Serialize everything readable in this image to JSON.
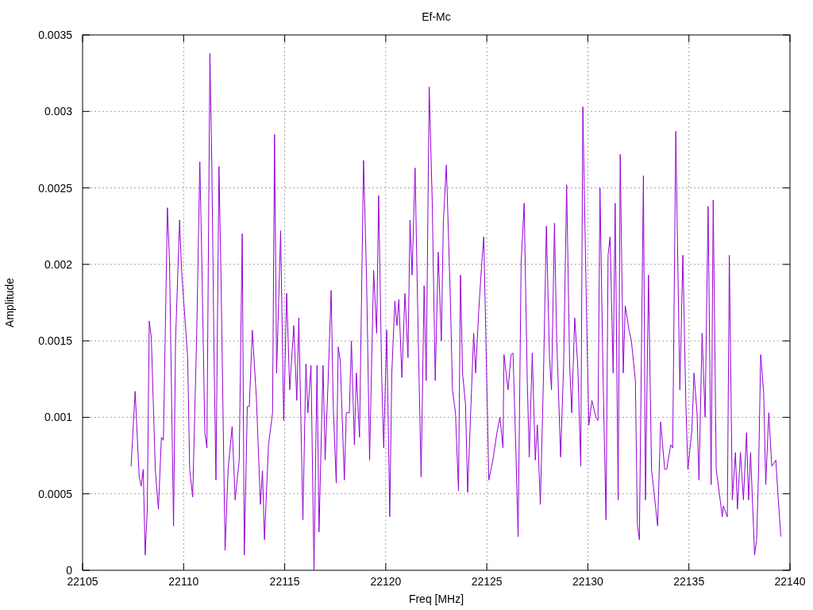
{
  "chart_data": {
    "type": "line",
    "grid": true,
    "title": "Ef-Mc",
    "xlabel": "Freq [MHz]",
    "ylabel": "Amplitude",
    "xlim": [
      22105,
      22140
    ],
    "ylim": [
      0,
      0.0035
    ],
    "xticks": [
      22105,
      22110,
      22115,
      22120,
      22125,
      22130,
      22135,
      22140
    ],
    "yticks": [
      0,
      0.0005,
      0.001,
      0.0015,
      0.002,
      0.0025,
      0.003,
      0.0035
    ],
    "x": [
      22107.4,
      22107.6,
      22107.8,
      22107.9,
      22108.0,
      22108.1,
      22108.2,
      22108.3,
      22108.4,
      22108.6,
      22108.75,
      22108.9,
      22109.0,
      22109.2,
      22109.3,
      22109.5,
      22109.6,
      22109.8,
      22109.9,
      22110.2,
      22110.3,
      22110.45,
      22110.65,
      22110.8,
      22110.9,
      22111.05,
      22111.15,
      22111.3,
      22111.4,
      22111.5,
      22111.6,
      22111.75,
      22111.85,
      22112.05,
      22112.2,
      22112.4,
      22112.55,
      22112.75,
      22112.9,
      22113.0,
      22113.15,
      22113.25,
      22113.4,
      22113.6,
      22113.8,
      22113.9,
      22114.0,
      22114.2,
      22114.4,
      22114.5,
      22114.6,
      22114.8,
      22114.95,
      22115.1,
      22115.25,
      22115.45,
      22115.6,
      22115.7,
      22115.9,
      22116.05,
      22116.15,
      22116.3,
      22116.45,
      22116.6,
      22116.7,
      22116.9,
      22117.0,
      22117.15,
      22117.3,
      22117.4,
      22117.55,
      22117.65,
      22117.75,
      22117.95,
      22118.05,
      22118.2,
      22118.3,
      22118.45,
      22118.55,
      22118.7,
      22118.9,
      22119.05,
      22119.2,
      22119.4,
      22119.55,
      22119.65,
      22119.8,
      22119.9,
      22120.05,
      22120.2,
      22120.3,
      22120.45,
      22120.55,
      22120.65,
      22120.8,
      22120.95,
      22121.1,
      22121.2,
      22121.3,
      22121.45,
      22121.6,
      22121.75,
      22121.9,
      22122.0,
      22122.15,
      22122.3,
      22122.45,
      22122.6,
      22122.75,
      22122.85,
      22123.0,
      22123.2,
      22123.3,
      22123.45,
      22123.6,
      22123.7,
      22123.8,
      22123.95,
      22124.05,
      22124.15,
      22124.35,
      22124.45,
      22124.6,
      22124.75,
      22124.85,
      22125.0,
      22125.1,
      22125.3,
      22125.5,
      22125.65,
      22125.8,
      22125.85,
      22126.05,
      22126.2,
      22126.3,
      22126.45,
      22126.55,
      22126.7,
      22126.85,
      22127.0,
      22127.1,
      22127.25,
      22127.4,
      22127.5,
      22127.65,
      22127.8,
      22127.95,
      22128.1,
      22128.2,
      22128.35,
      22128.45,
      22128.65,
      22128.8,
      22128.95,
      22129.1,
      22129.2,
      22129.35,
      22129.5,
      22129.65,
      22129.75,
      22129.95,
      22130.05,
      22130.2,
      22130.4,
      22130.5,
      22130.6,
      22130.75,
      22130.9,
      22131.0,
      22131.1,
      22131.25,
      22131.35,
      22131.5,
      22131.6,
      22131.75,
      22131.85,
      22132.05,
      22132.15,
      22132.35,
      22132.45,
      22132.55,
      22132.75,
      22132.85,
      22133.0,
      22133.15,
      22133.3,
      22133.45,
      22133.6,
      22133.8,
      22133.9,
      22134.1,
      22134.2,
      22134.35,
      22134.45,
      22134.55,
      22134.7,
      22134.85,
      22134.95,
      22135.15,
      22135.25,
      22135.4,
      22135.5,
      22135.65,
      22135.8,
      22135.95,
      22136.1,
      22136.2,
      22136.35,
      22136.5,
      22136.65,
      22136.7,
      22136.9,
      22137.0,
      22137.15,
      22137.3,
      22137.4,
      22137.55,
      22137.7,
      22137.85,
      22137.95,
      22138.05,
      22138.25,
      22138.35,
      22138.45,
      22138.55,
      22138.7,
      22138.8,
      22138.95,
      22139.1,
      22139.3,
      22139.4,
      22139.55
    ],
    "series": [
      {
        "color": "#9400d3",
        "values": [
          0.00068,
          0.00117,
          0.00061,
          0.00055,
          0.00066,
          0.0001,
          0.0004,
          0.00163,
          0.00152,
          0.00066,
          0.0004,
          0.00087,
          0.00085,
          0.00237,
          0.00202,
          0.00029,
          0.0015,
          0.00229,
          0.00196,
          0.00139,
          0.00066,
          0.00048,
          0.00155,
          0.00267,
          0.00202,
          0.0009,
          0.0008,
          0.00338,
          0.00262,
          0.00144,
          0.00059,
          0.00264,
          0.00191,
          0.00013,
          0.00066,
          0.00094,
          0.00046,
          0.00072,
          0.0022,
          0.0001,
          0.00107,
          0.00107,
          0.00157,
          0.00113,
          0.00043,
          0.00065,
          0.0002,
          0.00082,
          0.00103,
          0.00285,
          0.00129,
          0.00222,
          0.00098,
          0.00181,
          0.00118,
          0.0016,
          0.00111,
          0.00165,
          0.00033,
          0.00135,
          0.00103,
          0.00134,
          0,
          0.00134,
          0.00025,
          0.00134,
          0.00072,
          0.00124,
          0.00183,
          0.00108,
          0.00057,
          0.00146,
          0.00137,
          0.00059,
          0.00103,
          0.00103,
          0.0015,
          0.00082,
          0.00129,
          0.00087,
          0.00268,
          0.00191,
          0.00072,
          0.00196,
          0.00155,
          0.00245,
          0.00126,
          0.0008,
          0.00157,
          0.00035,
          0.00129,
          0.00176,
          0.0016,
          0.00177,
          0.00126,
          0.00181,
          0.00139,
          0.00229,
          0.00193,
          0.00263,
          0.00157,
          0.00061,
          0.00186,
          0.00124,
          0.00316,
          0.00241,
          0.00124,
          0.00208,
          0.0015,
          0.00227,
          0.00265,
          0.00176,
          0.00118,
          0.00103,
          0.00052,
          0.00193,
          0.00129,
          0.00108,
          0.00051,
          0.00085,
          0.00155,
          0.00129,
          0.0017,
          0.00201,
          0.00218,
          0.00124,
          0.00059,
          0.00072,
          0.0009,
          0.001,
          0.0008,
          0.00141,
          0.00118,
          0.00141,
          0.00142,
          0.00072,
          0.00022,
          0.00201,
          0.0024,
          0.00124,
          0.00074,
          0.00142,
          0.00072,
          0.00095,
          0.00043,
          0.00124,
          0.00225,
          0.00139,
          0.00118,
          0.00227,
          0.00155,
          0.00074,
          0.00134,
          0.00252,
          0.00134,
          0.00103,
          0.00165,
          0.00134,
          0.00068,
          0.00303,
          0.00155,
          0.00095,
          0.00111,
          0.001,
          0.00098,
          0.0025,
          0.00129,
          0.00033,
          0.00206,
          0.00218,
          0.00129,
          0.0024,
          0.00046,
          0.00272,
          0.00129,
          0.00173,
          0.00156,
          0.0015,
          0.00124,
          0.0003,
          0.0002,
          0.00258,
          0.00046,
          0.00193,
          0.00066,
          0.00048,
          0.00029,
          0.00097,
          0.00066,
          0.00066,
          0.00082,
          0.0008,
          0.00287,
          0.00201,
          0.00118,
          0.00206,
          0.00108,
          0.00066,
          0.00092,
          0.00129,
          0.00103,
          0.00059,
          0.00155,
          0.001,
          0.00238,
          0.00056,
          0.00242,
          0.00066,
          0.00051,
          0.00035,
          0.00042,
          0.00035,
          0.00206,
          0.00046,
          0.00077,
          0.0004,
          0.00077,
          0.00046,
          0.0009,
          0.00046,
          0.00077,
          0.0001,
          0.0002,
          0.00066,
          0.00141,
          0.00116,
          0.00056,
          0.00103,
          0.00068,
          0.00072,
          0.00051,
          0.00022
        ]
      }
    ]
  }
}
